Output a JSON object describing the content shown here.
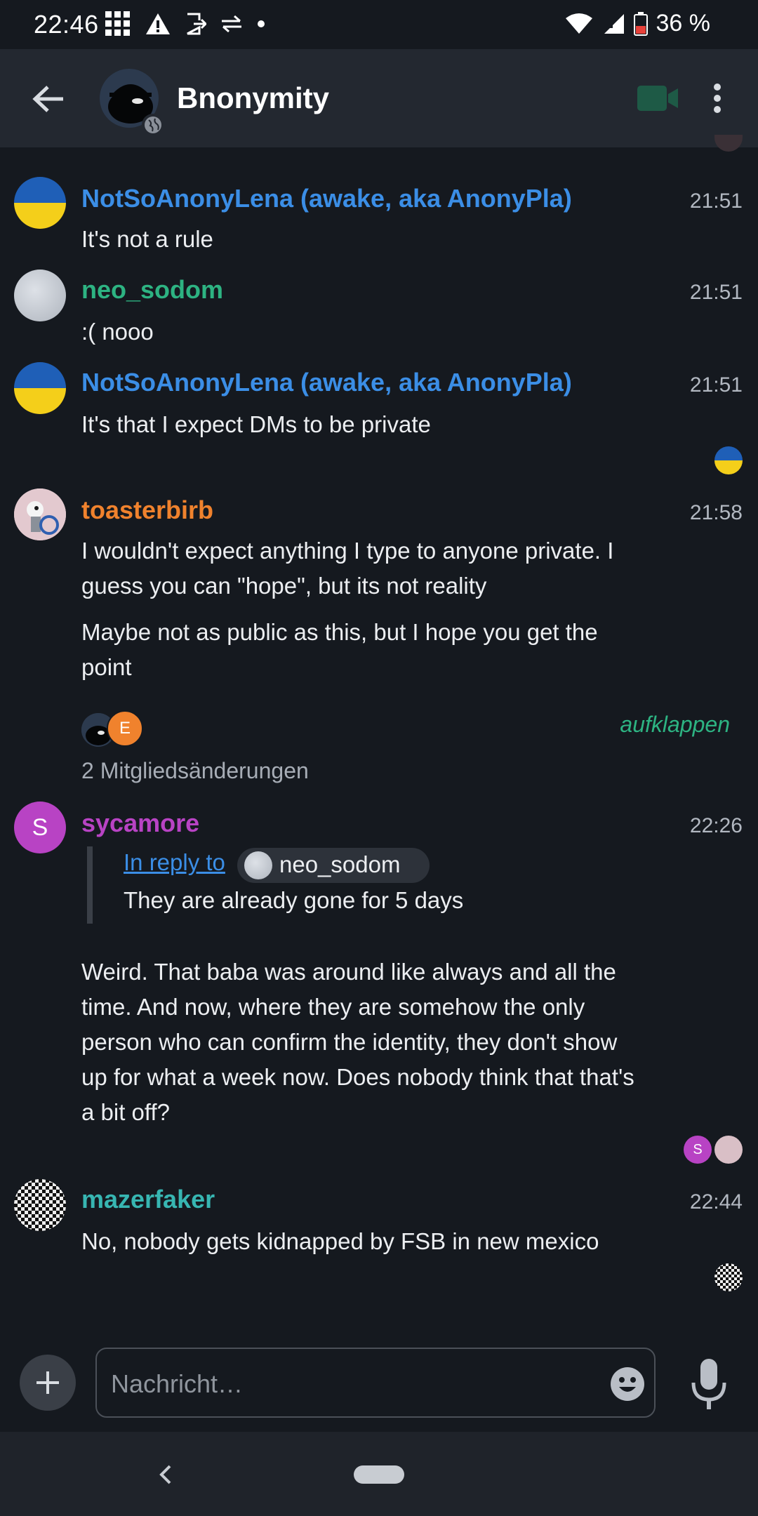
{
  "status_bar": {
    "time": "22:46",
    "battery": "36 %"
  },
  "header": {
    "title": "Bnonymity"
  },
  "colors": {
    "background": "#15191f",
    "appbar": "#232830",
    "accent_blue": "#3b8ee6",
    "accent_green": "#2db382"
  },
  "messages": [
    {
      "sender": "NotSoAnonyLena (awake, aka AnonyPla)",
      "time": "21:51",
      "lines": [
        "It's not a rule"
      ]
    },
    {
      "sender": "neo_sodom",
      "time": "21:51",
      "lines": [
        ":( nooo"
      ]
    },
    {
      "sender": "NotSoAnonyLena (awake, aka AnonyPla)",
      "time": "21:51",
      "lines": [
        "It's that I expect DMs to be private"
      ]
    },
    {
      "sender": "toasterbirb",
      "time": "21:58",
      "lines": [
        "I wouldn't expect anything I type to anyone private. I",
        "guess you can \"hope\", but its not reality",
        "Maybe not as public as this, but I hope you get the",
        "point"
      ]
    },
    {
      "sender": "sycamore",
      "time": "22:26",
      "avatar_letter": "S",
      "reply": {
        "link_label": "In reply to",
        "name": "neo_sodom",
        "text": "They are already gone for 5 days"
      },
      "lines": [
        "Weird. That baba was around like always and all the",
        "time. And now, where they are somehow the only",
        "person who can confirm the identity, they don't show",
        "up for what a week now. Does nobody think that that's",
        "a bit off?"
      ]
    },
    {
      "sender": "mazerfaker",
      "time": "22:44",
      "lines": [
        "No, nobody gets kidnapped by FSB in new mexico"
      ]
    }
  ],
  "membership": {
    "expand_label": "aufklappen",
    "summary": "2 Mitgliedsänderungen",
    "avatar_letter": "E"
  },
  "receipts": {
    "sycamore_letter": "S"
  },
  "composer": {
    "placeholder": "Nachricht…"
  },
  "icons": [
    "back-arrow-icon",
    "globe-icon",
    "video-call-icon",
    "more-vert-icon",
    "add-icon",
    "emoji-icon",
    "mic-icon",
    "nav-back-icon"
  ]
}
